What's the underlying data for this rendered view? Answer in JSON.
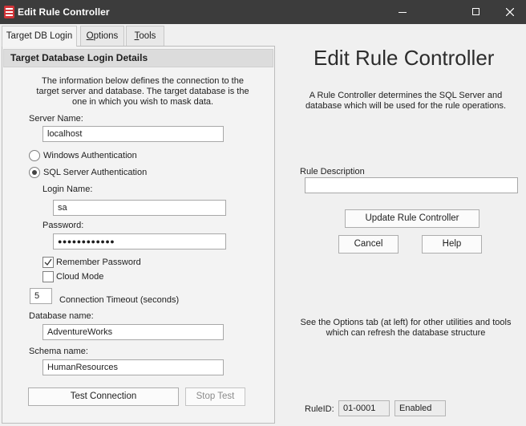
{
  "window": {
    "title": "Edit Rule Controller",
    "min_icon": "minimize-icon",
    "max_icon": "maximize-icon",
    "close_icon": "close-icon"
  },
  "tabs": [
    {
      "label": "Target DB Login",
      "active": true
    },
    {
      "label": "Options",
      "underline": "O",
      "rest": "ptions"
    },
    {
      "label": "Tools",
      "underline": "T",
      "rest": "ools"
    }
  ],
  "login": {
    "header": "Target Database Login Details",
    "description": "The information below defines the connection to the target server and database. The target database is the one in which you wish to mask data.",
    "server_label": "Server Name:",
    "server_value": "localhost",
    "windows_auth_label": "Windows Authentication",
    "sql_auth_label": "SQL Server Authentication",
    "login_label": "Login Name:",
    "login_value": "sa",
    "password_label": "Password:",
    "password_value": "●●●●●●●●●●●●",
    "remember_label": "Remember Password",
    "cloud_label": "Cloud Mode",
    "timeout_value": "5",
    "timeout_label": "Connection Timeout (seconds)",
    "database_label": "Database name:",
    "database_value": "AdventureWorks",
    "schema_label": "Schema name:",
    "schema_value": "HumanResources",
    "test_button": "Test Connection",
    "stop_button": "Stop Test"
  },
  "right": {
    "title": "Edit Rule Controller",
    "description": "A Rule Controller determines the SQL Server and database which will be used for the rule operations.",
    "rule_description_label": "Rule Description",
    "rule_description_value": "",
    "update_button": "Update Rule Controller",
    "cancel_button": "Cancel",
    "help_button": "Help",
    "options_hint": "See the Options tab (at left) for other utilities and tools which can refresh the database structure",
    "rule_id_label": "RuleID:",
    "rule_id_value": "01-0001",
    "status_value": "Enabled"
  },
  "colors": {
    "titlebar": "#3c3c3c",
    "app_icon": "#d13438"
  }
}
